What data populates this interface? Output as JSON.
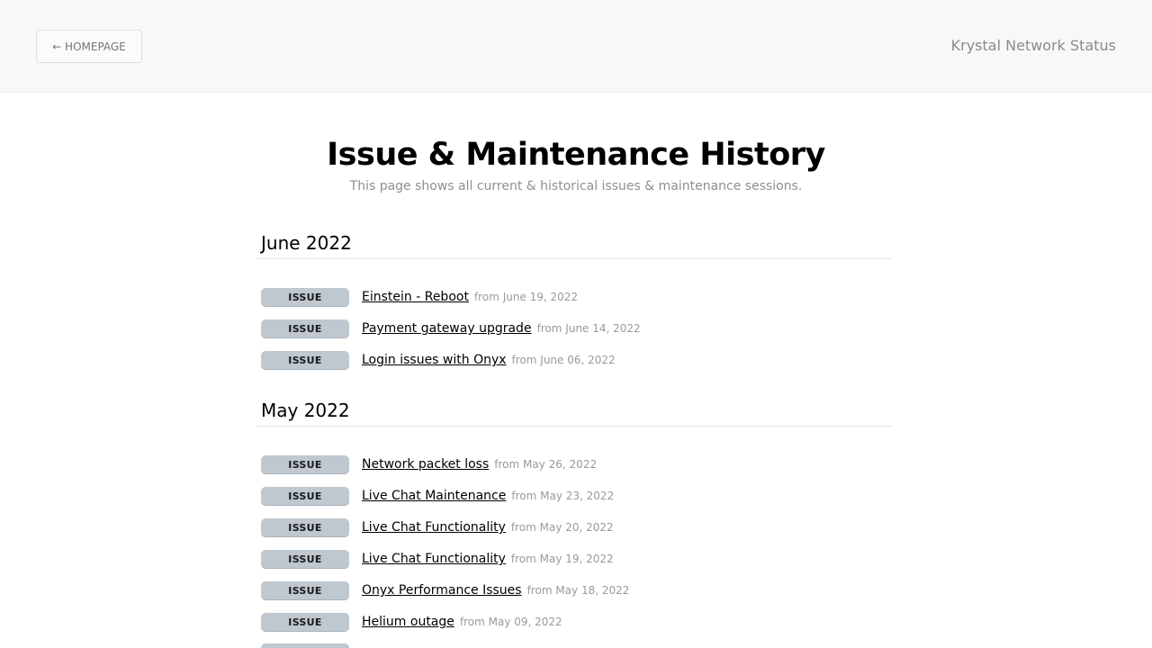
{
  "header": {
    "home_label": "← HOMEPAGE",
    "site_title": "Krystal Network Status"
  },
  "page": {
    "title": "Issue & Maintenance History",
    "subtitle": "This page shows all current & historical issues & maintenance sessions."
  },
  "months": [
    {
      "label": "June 2022",
      "items": [
        {
          "badge": "ISSUE",
          "title": "Einstein - Reboot",
          "date": "from June 19, 2022"
        },
        {
          "badge": "ISSUE",
          "title": "Payment gateway upgrade",
          "date": "from June 14, 2022"
        },
        {
          "badge": "ISSUE",
          "title": "Login issues with Onyx",
          "date": "from June 06, 2022"
        }
      ]
    },
    {
      "label": "May 2022",
      "items": [
        {
          "badge": "ISSUE",
          "title": "Network packet loss",
          "date": "from May 26, 2022"
        },
        {
          "badge": "ISSUE",
          "title": "Live Chat Maintenance",
          "date": "from May 23, 2022"
        },
        {
          "badge": "ISSUE",
          "title": "Live Chat Functionality",
          "date": "from May 20, 2022"
        },
        {
          "badge": "ISSUE",
          "title": "Live Chat Functionality",
          "date": "from May 19, 2022"
        },
        {
          "badge": "ISSUE",
          "title": "Onyx Performance Issues",
          "date": "from May 18, 2022"
        },
        {
          "badge": "ISSUE",
          "title": "Helium outage",
          "date": "from May 09, 2022"
        }
      ]
    }
  ],
  "colors": {
    "badge_bg": "#bfc7cf",
    "topbar_bg": "#f8f8f8",
    "muted_text": "#9a9a9a"
  }
}
